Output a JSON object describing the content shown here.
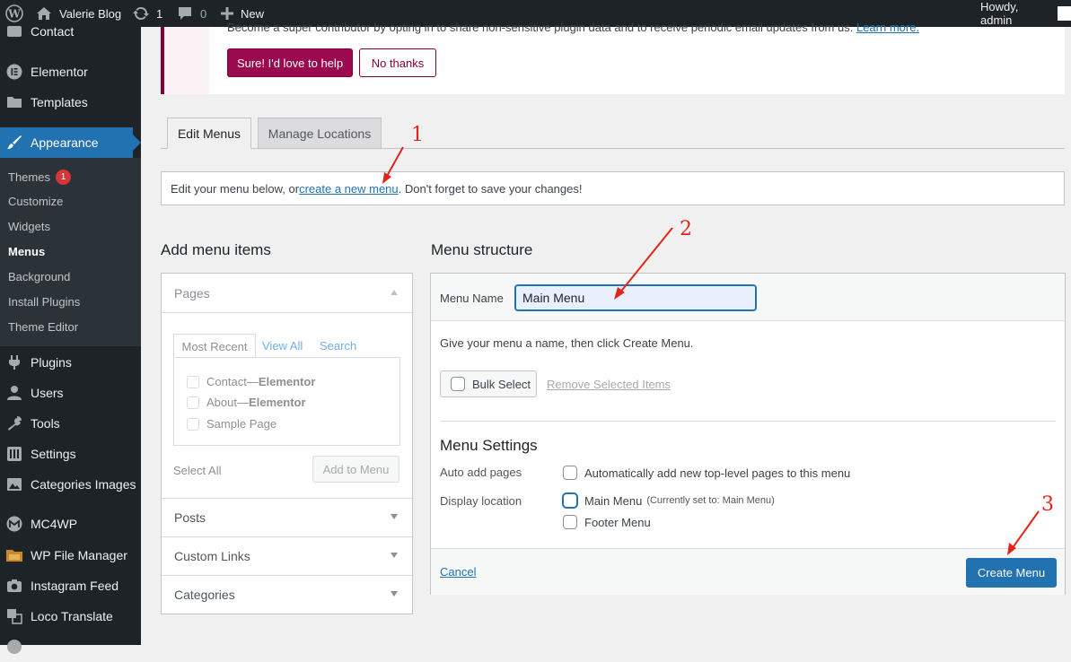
{
  "adminbar": {
    "site_name": "Valerie Blog",
    "updates_count": "1",
    "comments_count": "0",
    "new_label": "New",
    "howdy": "Howdy, admin"
  },
  "sidebar": {
    "items": [
      {
        "label": "Contact",
        "icon": "contact-icon"
      },
      {
        "label": "Elementor",
        "icon": "elementor-icon"
      },
      {
        "label": "Templates",
        "icon": "folder-icon"
      },
      {
        "label": "Appearance",
        "icon": "paintbrush-icon"
      },
      {
        "label": "Plugins",
        "icon": "plugin-icon"
      },
      {
        "label": "Users",
        "icon": "user-icon"
      },
      {
        "label": "Tools",
        "icon": "wrench-icon"
      },
      {
        "label": "Settings",
        "icon": "settings-icon"
      },
      {
        "label": "Categories Images",
        "icon": "image-icon"
      },
      {
        "label": "MC4WP",
        "icon": "mc4wp-icon"
      },
      {
        "label": "WP File Manager",
        "icon": "file-manager-icon"
      },
      {
        "label": "Instagram Feed",
        "icon": "camera-icon"
      },
      {
        "label": "Loco Translate",
        "icon": "translate-icon"
      }
    ],
    "submenu": [
      {
        "label": "Themes",
        "badge": "1"
      },
      {
        "label": "Customize"
      },
      {
        "label": "Widgets"
      },
      {
        "label": "Menus"
      },
      {
        "label": "Background"
      },
      {
        "label": "Install Plugins"
      },
      {
        "label": "Theme Editor"
      }
    ]
  },
  "notice": {
    "text": "Become a super contributor by opting in to share non-sensitive plugin data and to receive periodic email updates from us.",
    "learn_more": "Learn more.",
    "accept_label": "Sure! I'd love to help",
    "decline_label": "No thanks"
  },
  "tabs": {
    "edit_menus": "Edit Menus",
    "manage_locations": "Manage Locations"
  },
  "info": {
    "before": "Edit your menu below, or ",
    "link": "create a new menu",
    "after": ". Don't forget to save your changes!"
  },
  "add_items": {
    "heading": "Add menu items",
    "pages_title": "Pages",
    "inner_tabs": [
      "Most Recent",
      "View All",
      "Search"
    ],
    "pages": [
      {
        "title": "Contact",
        "suffix": " — ",
        "builder": "Elementor"
      },
      {
        "title": "About",
        "suffix": " — ",
        "builder": "Elementor"
      },
      {
        "title": "Sample Page",
        "suffix": "",
        "builder": ""
      }
    ],
    "select_all": "Select All",
    "add_to_menu": "Add to Menu",
    "sections": [
      "Posts",
      "Custom Links",
      "Categories"
    ]
  },
  "structure": {
    "heading": "Menu structure",
    "menu_name_label": "Menu Name",
    "menu_name_value": "Main Menu",
    "instructions": "Give your menu a name, then click Create Menu.",
    "bulk_select": "Bulk Select",
    "remove_selected": "Remove Selected Items",
    "settings_heading": "Menu Settings",
    "auto_add_label": "Auto add pages",
    "auto_add_text": "Automatically add new top-level pages to this menu",
    "display_location_label": "Display location",
    "locations": [
      {
        "label": "Main Menu",
        "note": "(Currently set to: Main Menu)"
      },
      {
        "label": "Footer Menu",
        "note": ""
      }
    ],
    "cancel": "Cancel",
    "create_menu": "Create Menu"
  },
  "annotations": [
    "1",
    "2",
    "3"
  ],
  "colors": {
    "admin_dark": "#1d2327",
    "accent_blue": "#2271b1",
    "notice_accent": "#9b0a4f",
    "annotation_red": "#e3241b",
    "badge_red": "#d63638"
  }
}
